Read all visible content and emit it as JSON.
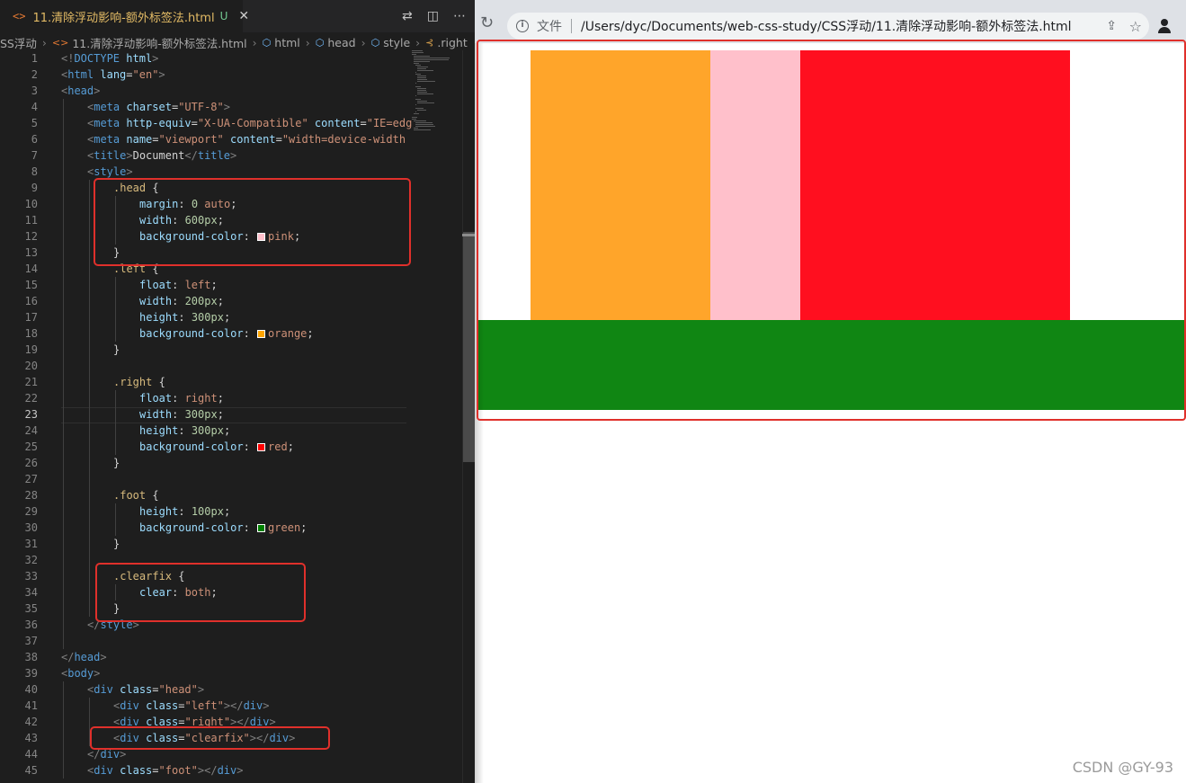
{
  "editor": {
    "tab": {
      "title": "11.清除浮动影响-额外标签法.html",
      "status": "U",
      "close": "✕"
    },
    "breadcrumb": {
      "folder": "SS浮动",
      "file": "11.清除浮动影响-额外标签法.html",
      "html": "html",
      "head": "head",
      "style": "style",
      "right": ".right"
    },
    "code_lines": [
      {
        "n": "1",
        "i": 0,
        "h": "<span class='t-br'>&lt;!</span><span class='t-tag'>DOCTYPE</span> <span class='t-at'>html</span><span class='t-br'>&gt;</span>"
      },
      {
        "n": "2",
        "i": 0,
        "h": "<span class='t-br'>&lt;</span><span class='t-tag'>html</span> <span class='t-at'>lang</span>=<span class='t-st'>\"en\"</span><span class='t-br'>&gt;</span>"
      },
      {
        "n": "3",
        "i": 0,
        "h": "<span class='t-br'>&lt;</span><span class='t-tag'>head</span><span class='t-br'>&gt;</span>"
      },
      {
        "n": "4",
        "i": 1,
        "h": "<span class='t-br'>&lt;</span><span class='t-tag'>meta</span> <span class='t-at'>charset</span>=<span class='t-st'>\"UTF-8\"</span><span class='t-br'>&gt;</span>"
      },
      {
        "n": "5",
        "i": 1,
        "h": "<span class='t-br'>&lt;</span><span class='t-tag'>meta</span> <span class='t-at'>http-equiv</span>=<span class='t-st'>\"X-UA-Compatible\"</span> <span class='t-at'>content</span>=<span class='t-st'>\"IE=edg</span>"
      },
      {
        "n": "6",
        "i": 1,
        "h": "<span class='t-br'>&lt;</span><span class='t-tag'>meta</span> <span class='t-at'>name</span>=<span class='t-st'>\"viewport\"</span> <span class='t-at'>content</span>=<span class='t-st'>\"width=device-width</span>"
      },
      {
        "n": "7",
        "i": 1,
        "h": "<span class='t-br'>&lt;</span><span class='t-tag'>title</span><span class='t-br'>&gt;</span><span class='t-tx'>Document</span><span class='t-br'>&lt;/</span><span class='t-tag'>title</span><span class='t-br'>&gt;</span>"
      },
      {
        "n": "8",
        "i": 1,
        "h": "<span class='t-br'>&lt;</span><span class='t-tag'>style</span><span class='t-br'>&gt;</span>"
      },
      {
        "n": "9",
        "i": 2,
        "h": "<span class='t-sel'>.head</span> <span class='t-tx'>{</span>"
      },
      {
        "n": "10",
        "i": 3,
        "h": "<span class='t-pr'>margin</span>: <span class='t-num'>0</span> <span class='t-val'>auto</span>;"
      },
      {
        "n": "11",
        "i": 3,
        "h": "<span class='t-pr'>width</span>: <span class='t-num'>600px</span>;"
      },
      {
        "n": "12",
        "i": 3,
        "h": "<span class='t-pr'>background-color</span>: <span class='swatch' style='background:pink'></span><span class='t-val'>pink</span>;"
      },
      {
        "n": "13",
        "i": 2,
        "h": "<span class='t-tx'>}</span>"
      },
      {
        "n": "14",
        "i": 2,
        "h": "<span class='t-sel'>.left</span> <span class='t-tx'>{</span>"
      },
      {
        "n": "15",
        "i": 3,
        "h": "<span class='t-pr'>float</span>: <span class='t-val'>left</span>;"
      },
      {
        "n": "16",
        "i": 3,
        "h": "<span class='t-pr'>width</span>: <span class='t-num'>200px</span>;"
      },
      {
        "n": "17",
        "i": 3,
        "h": "<span class='t-pr'>height</span>: <span class='t-num'>300px</span>;"
      },
      {
        "n": "18",
        "i": 3,
        "h": "<span class='t-pr'>background-color</span>: <span class='swatch' style='background:orange'></span><span class='t-val'>orange</span>;"
      },
      {
        "n": "19",
        "i": 2,
        "h": "<span class='t-tx'>}</span>"
      },
      {
        "n": "20",
        "i": 0,
        "h": ""
      },
      {
        "n": "21",
        "i": 2,
        "h": "<span class='t-sel'>.right</span> <span class='t-tx'>{</span>"
      },
      {
        "n": "22",
        "i": 3,
        "h": "<span class='t-pr'>float</span>: <span class='t-val'>right</span>;"
      },
      {
        "n": "23",
        "i": 3,
        "h": "<span class='t-pr'>width</span>: <span class='t-num'>300px</span>;"
      },
      {
        "n": "24",
        "i": 3,
        "h": "<span class='t-pr'>height</span>: <span class='t-num'>300px</span>;"
      },
      {
        "n": "25",
        "i": 3,
        "h": "<span class='t-pr'>background-color</span>: <span class='swatch' style='background:red'></span><span class='t-val'>red</span>;"
      },
      {
        "n": "26",
        "i": 2,
        "h": "<span class='t-tx'>}</span>"
      },
      {
        "n": "27",
        "i": 0,
        "h": ""
      },
      {
        "n": "28",
        "i": 2,
        "h": "<span class='t-sel'>.foot</span> <span class='t-tx'>{</span>"
      },
      {
        "n": "29",
        "i": 3,
        "h": "<span class='t-pr'>height</span>: <span class='t-num'>100px</span>;"
      },
      {
        "n": "30",
        "i": 3,
        "h": "<span class='t-pr'>background-color</span>: <span class='swatch' style='background:green'></span><span class='t-val'>green</span>;"
      },
      {
        "n": "31",
        "i": 2,
        "h": "<span class='t-tx'>}</span>"
      },
      {
        "n": "32",
        "i": 0,
        "h": ""
      },
      {
        "n": "33",
        "i": 2,
        "h": "<span class='t-sel'>.clearfix</span> <span class='t-tx'>{</span>"
      },
      {
        "n": "34",
        "i": 3,
        "h": "<span class='t-pr'>clear</span>: <span class='t-val'>both</span>;"
      },
      {
        "n": "35",
        "i": 2,
        "h": "<span class='t-tx'>}</span>"
      },
      {
        "n": "36",
        "i": 1,
        "h": "<span class='t-br'>&lt;/</span><span class='t-tag'>style</span><span class='t-br'>&gt;</span>"
      },
      {
        "n": "37",
        "i": 0,
        "h": ""
      },
      {
        "n": "38",
        "i": 0,
        "h": "<span class='t-br'>&lt;/</span><span class='t-tag'>head</span><span class='t-br'>&gt;</span>"
      },
      {
        "n": "39",
        "i": 0,
        "h": "<span class='t-br'>&lt;</span><span class='t-tag'>body</span><span class='t-br'>&gt;</span>"
      },
      {
        "n": "40",
        "i": 1,
        "h": "<span class='t-br'>&lt;</span><span class='t-tag'>div</span> <span class='t-at'>class</span>=<span class='t-st'>\"head\"</span><span class='t-br'>&gt;</span>"
      },
      {
        "n": "41",
        "i": 2,
        "h": "<span class='t-br'>&lt;</span><span class='t-tag'>div</span> <span class='t-at'>class</span>=<span class='t-st'>\"left\"</span><span class='t-br'>&gt;&lt;/</span><span class='t-tag'>div</span><span class='t-br'>&gt;</span>"
      },
      {
        "n": "42",
        "i": 2,
        "h": "<span class='t-br'>&lt;</span><span class='t-tag'>div</span> <span class='t-at'>class</span>=<span class='t-st'>\"right\"</span><span class='t-br'>&gt;&lt;/</span><span class='t-tag'>div</span><span class='t-br'>&gt;</span>"
      },
      {
        "n": "43",
        "i": 2,
        "h": "<span class='t-br'>&lt;</span><span class='t-tag'>div</span> <span class='t-at'>class</span>=<span class='t-st'>\"clearfix\"</span><span class='t-br'>&gt;&lt;/</span><span class='t-tag'>div</span><span class='t-br'>&gt;</span>"
      },
      {
        "n": "44",
        "i": 1,
        "h": "<span class='t-br'>&lt;/</span><span class='t-tag'>div</span><span class='t-br'>&gt;</span>"
      },
      {
        "n": "45",
        "i": 1,
        "h": "<span class='t-br'>&lt;</span><span class='t-tag'>div</span> <span class='t-at'>class</span>=<span class='t-st'>\"foot\"</span><span class='t-br'>&gt;&lt;/</span><span class='t-tag'>div</span><span class='t-br'>&gt;</span>"
      }
    ],
    "active_line": "23"
  },
  "browser": {
    "file_label": "文件",
    "url": "/Users/dyc/Documents/web-css-study/CSS浮动/11.清除浮动影响-额外标签法.html"
  },
  "colors": {
    "pink": "#ffc0cb",
    "orange": "#ffa52a",
    "red": "#ff0f1f",
    "green": "#108613",
    "highlight_box": "#e0302b"
  },
  "watermark": "CSDN @GY-93"
}
